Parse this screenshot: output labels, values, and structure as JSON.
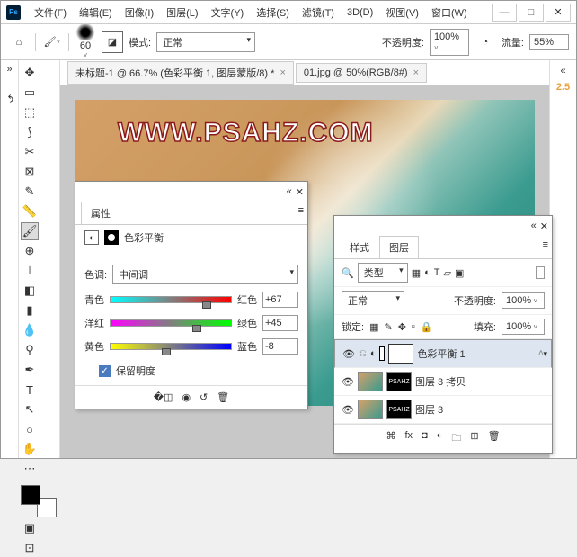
{
  "menu": [
    "文件(F)",
    "编辑(E)",
    "图像(I)",
    "图层(L)",
    "文字(Y)",
    "选择(S)",
    "滤镜(T)",
    "3D(D)",
    "视图(V)",
    "窗口(W)"
  ],
  "optbar": {
    "brush_size": "60",
    "mode_label": "模式:",
    "mode_value": "正常",
    "opacity_label": "不透明度:",
    "opacity_value": "100%",
    "flow_label": "流量:",
    "flow_value": "55%"
  },
  "tabs": [
    "未标题-1 @ 66.7% (色彩平衡 1, 图层蒙版/8) *",
    "01.jpg @ 50%(RGB/8#)"
  ],
  "watermark": "WWW.PSAHZ.COM",
  "version": "2.5",
  "props": {
    "panel_tab": "属性",
    "title": "色彩平衡",
    "tone_label": "色调:",
    "tone_value": "中间调",
    "cyan": "青色",
    "red": "红色",
    "magenta": "洋红",
    "green": "绿色",
    "yellow": "黄色",
    "blue": "蓝色",
    "v1": "+67",
    "v2": "+45",
    "v3": "-8",
    "preserve": "保留明度"
  },
  "layers": {
    "tab_style": "样式",
    "tab_layers": "图层",
    "kind_label": "类型",
    "blend": "正常",
    "opacity_label": "不透明度:",
    "opacity": "100%",
    "lock_label": "锁定:",
    "fill_label": "填充:",
    "fill": "100%",
    "l1": "色彩平衡 1",
    "l2": "图层 3 拷贝",
    "l3": "图层 3"
  },
  "search_placeholder": "ᑭ"
}
